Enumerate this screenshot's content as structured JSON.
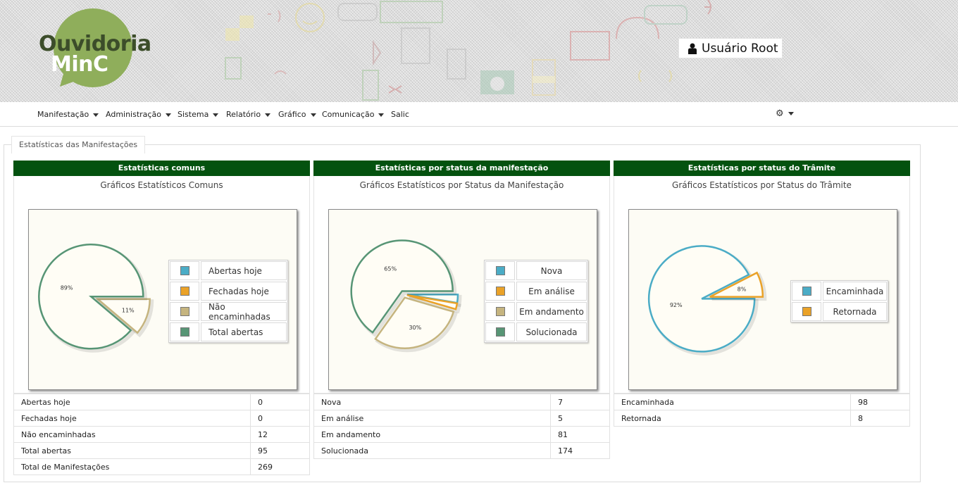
{
  "app": {
    "logo_line1": "Ouvidoria",
    "logo_line2": "MinC",
    "user_label": "Usuário Root",
    "colors": {
      "logo_circle": "#8fae5b",
      "panel_header": "#04520f"
    }
  },
  "nav": {
    "items": [
      {
        "label": "Manifestação",
        "has_caret": true
      },
      {
        "label": "Administração",
        "has_caret": true
      },
      {
        "label": "Sistema",
        "has_caret": true
      },
      {
        "label": "Relatório",
        "has_caret": true
      },
      {
        "label": "Gráfico",
        "has_caret": true
      },
      {
        "label": "Comunicação",
        "has_caret": true
      },
      {
        "label": "Salic",
        "has_caret": false
      }
    ],
    "settings_icon": "gear-icon"
  },
  "section": {
    "title": "Estatísticas das Manifestações"
  },
  "panels": [
    {
      "header": "Estatísticas comuns",
      "chart_title": "Gráficos Estatísticos Comuns",
      "legend": [
        {
          "label": "Abertas hoje",
          "color": "#4bacc6"
        },
        {
          "label": "Fechadas hoje",
          "color": "#eaa228"
        },
        {
          "label": "Não encaminhadas",
          "color": "#c5b47f"
        },
        {
          "label": "Total abertas",
          "color": "#579575"
        }
      ],
      "rows": [
        {
          "label": "Abertas hoje",
          "value": "0"
        },
        {
          "label": "Fechadas hoje",
          "value": "0"
        },
        {
          "label": "Não encaminhadas",
          "value": "12"
        },
        {
          "label": "Total abertas",
          "value": "95"
        },
        {
          "label": "Total de Manifestações",
          "value": "269"
        }
      ]
    },
    {
      "header": "Estatísticas por status da manifestação",
      "chart_title": "Gráficos Estatísticos por Status da Manifestação",
      "legend": [
        {
          "label": "Nova",
          "color": "#4bacc6"
        },
        {
          "label": "Em análise",
          "color": "#eaa228"
        },
        {
          "label": "Em andamento",
          "color": "#c5b47f"
        },
        {
          "label": "Solucionada",
          "color": "#579575"
        }
      ],
      "rows": [
        {
          "label": "Nova",
          "value": "7"
        },
        {
          "label": "Em análise",
          "value": "5"
        },
        {
          "label": "Em andamento",
          "value": "81"
        },
        {
          "label": "Solucionada",
          "value": "174"
        }
      ]
    },
    {
      "header": "Estatísticas por status do Trâmite",
      "chart_title": "Gráficos Estatísticos por Status do Trâmite",
      "legend": [
        {
          "label": "Encaminhada",
          "color": "#4bacc6"
        },
        {
          "label": "Retornada",
          "color": "#eaa228"
        }
      ],
      "rows": [
        {
          "label": "Encaminhada",
          "value": "98"
        },
        {
          "label": "Retornada",
          "value": "8"
        }
      ]
    }
  ],
  "chart_data": [
    {
      "type": "pie",
      "title": "Gráficos Estatísticos Comuns",
      "categories": [
        "Abertas hoje",
        "Fechadas hoje",
        "Não encaminhadas",
        "Total abertas"
      ],
      "values": [
        0,
        0,
        12,
        95
      ],
      "colors": [
        "#4bacc6",
        "#eaa228",
        "#c5b47f",
        "#579575"
      ],
      "slice_labels": [
        "",
        "",
        "11%",
        "89%"
      ],
      "legend_position": "right"
    },
    {
      "type": "pie",
      "title": "Gráficos Estatísticos por Status da Manifestação",
      "categories": [
        "Nova",
        "Em análise",
        "Em andamento",
        "Solucionada"
      ],
      "values": [
        7,
        5,
        81,
        174
      ],
      "colors": [
        "#4bacc6",
        "#eaa228",
        "#c5b47f",
        "#579575"
      ],
      "slice_labels": [
        "",
        "",
        "30%",
        "65%"
      ],
      "legend_position": "right"
    },
    {
      "type": "pie",
      "title": "Gráficos Estatísticos por Status do Trâmite",
      "categories": [
        "Encaminhada",
        "Retornada"
      ],
      "values": [
        98,
        8
      ],
      "colors": [
        "#4bacc6",
        "#eaa228"
      ],
      "slice_labels": [
        "92%",
        "8%"
      ],
      "legend_position": "right"
    }
  ]
}
